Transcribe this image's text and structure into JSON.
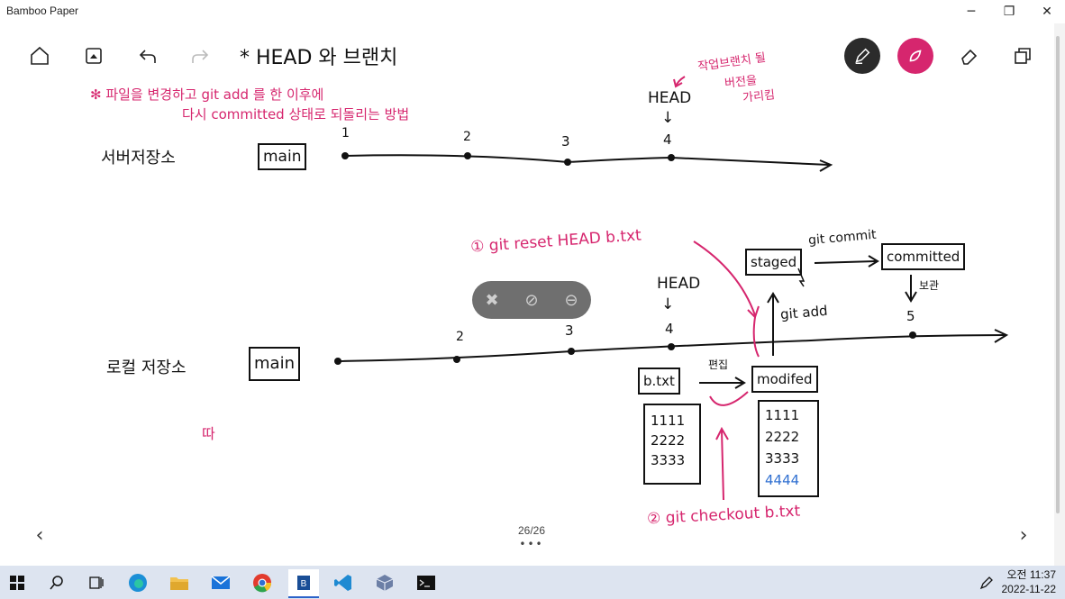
{
  "window": {
    "title": "Bamboo Paper",
    "minimize": "─",
    "maximize": "❐",
    "close": "✕"
  },
  "toolbar": {
    "title": "*  HEAD 와 브랜치",
    "pen_color": "#d6266e"
  },
  "note": {
    "star_text_1": "✻ 파일을 변경하고 git add 를 한 이후에",
    "star_text_2": "다시 committed 상태로 되돌리는 방법",
    "server_label": "서버저장소",
    "local_label": "로컬 저장소",
    "main_label": "main",
    "server_ticks": [
      "1",
      "2",
      "3",
      "4"
    ],
    "local_ticks": [
      "2",
      "3",
      "4",
      "5"
    ],
    "head_label": "HEAD",
    "arrow_down": "↓",
    "side_note_1": "작업브랜치 될",
    "side_note_2": "버전을",
    "side_note_3": "가리킴",
    "reset_cmd": "① git reset HEAD b.txt",
    "staged": "staged",
    "git_commit": "git commit",
    "committed": "committed",
    "save": "보관",
    "git_add": "git add",
    "btxt": "b.txt",
    "edit": "편집",
    "modified": "modifed",
    "file1": [
      "1111",
      "2222",
      "3333"
    ],
    "file2": [
      "1111",
      "2222",
      "3333",
      "4444"
    ],
    "checkout_cmd": "② git checkout b.txt",
    "stray": "따"
  },
  "page": {
    "counter": "26/26",
    "dots": "•••"
  },
  "taskbar": {
    "time": "오전 11:37",
    "date": "2022-11-22"
  }
}
